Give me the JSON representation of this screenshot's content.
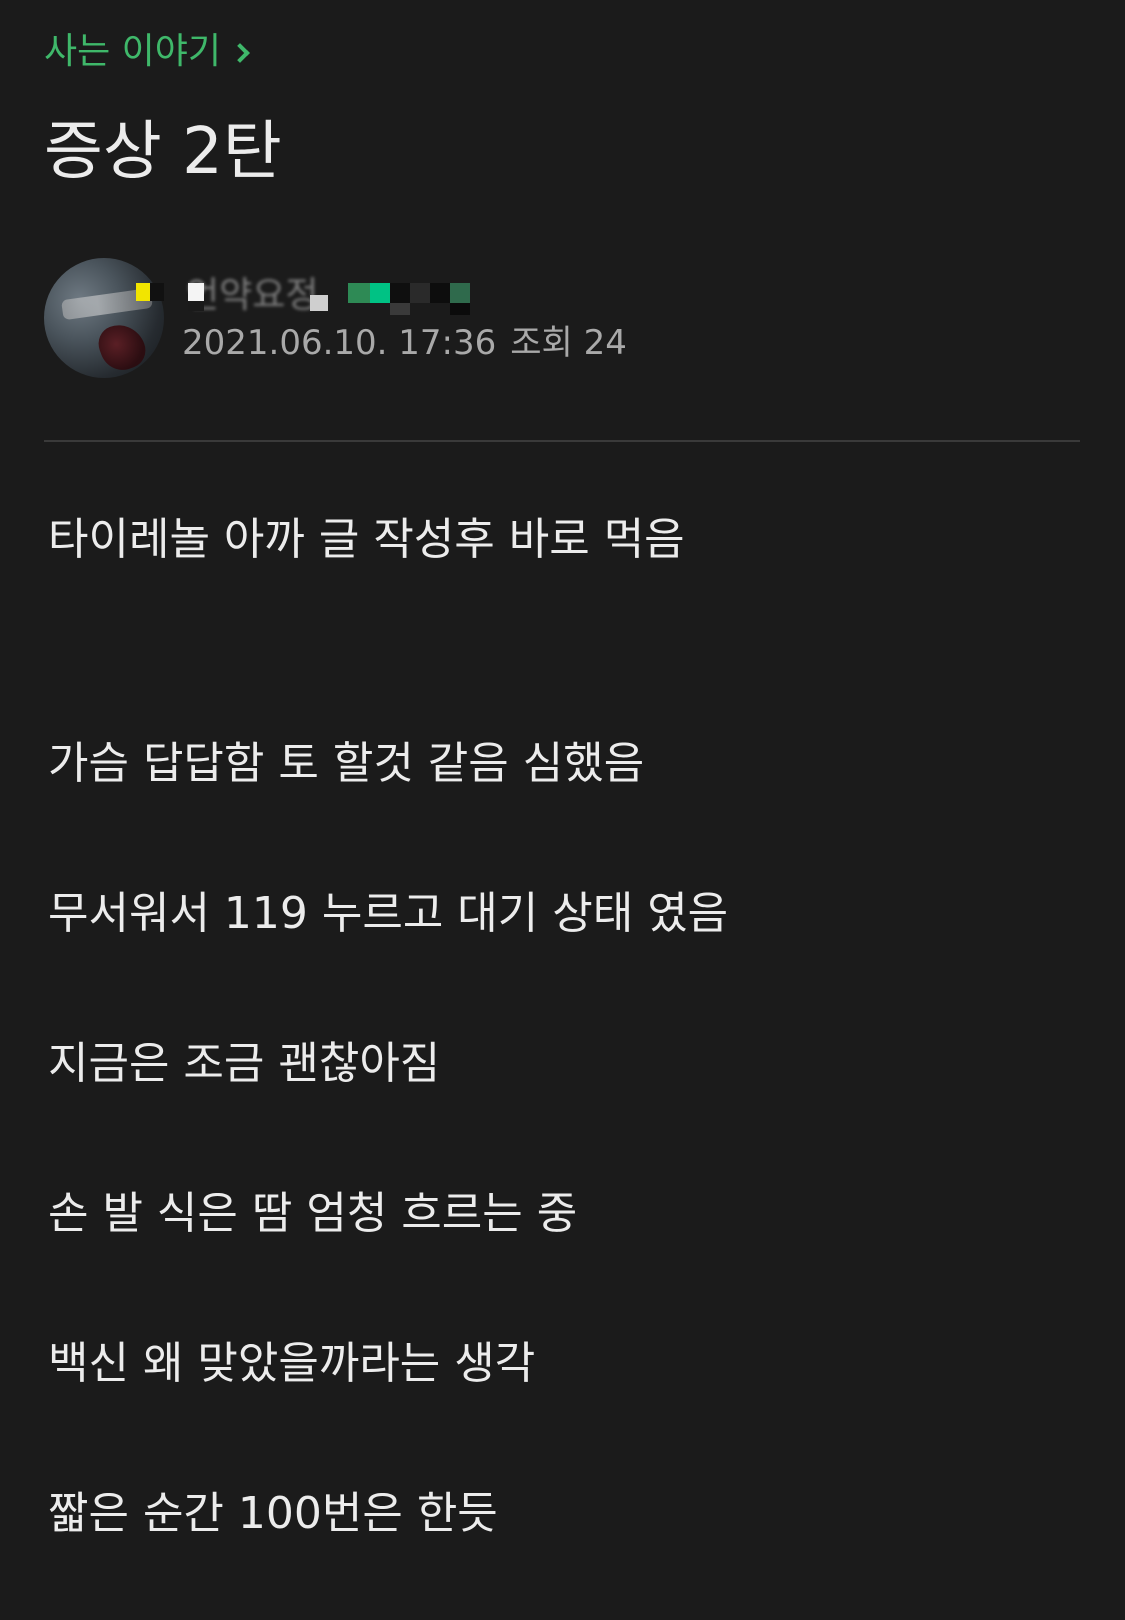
{
  "board": {
    "name": "사는 이야기"
  },
  "post": {
    "title": "증상 2탄",
    "author": {
      "nickname": "언약요정"
    },
    "date": "2021.06.10. 17:36",
    "views_label": "조회 24",
    "body": [
      "타이레놀 아까 글 작성후 바로 먹음",
      "가슴 답답함 토 할것 같음 심했음",
      "무서워서 119 누르고 대기 상태 였음",
      "지금은 조금 괜찮아짐",
      "손 발 식은 땀 엄청 흐르는 중",
      "백신 왜 맞았을까라는 생각",
      "짧은 순간 100번은 한듯"
    ]
  },
  "colors": {
    "background": "#1b1b1b",
    "accent": "#3fb86a",
    "text": "#ececec",
    "meta": "#a9a9a9",
    "divider": "#3a3a3a"
  },
  "icons": {
    "board_link": "chevron-right-icon"
  }
}
